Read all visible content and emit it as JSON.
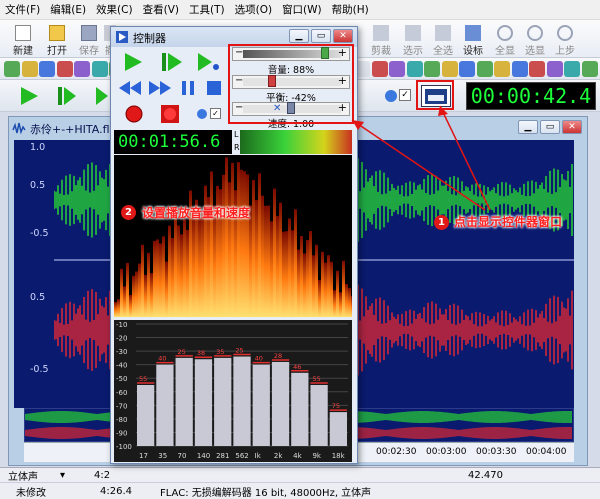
{
  "menu": [
    "文件(F)",
    "编辑(E)",
    "效果(C)",
    "查看(V)",
    "工具(T)",
    "选项(O)",
    "窗口(W)",
    "帮助(H)"
  ],
  "toolbar1": {
    "left": [
      "新建",
      "打开",
      "保存",
      "撤"
    ],
    "right": [
      "剪裁",
      "选示",
      "全选",
      "设标",
      "全显",
      "选显",
      "上步"
    ]
  },
  "main_time": "00:00:42.4",
  "document": {
    "title": "赤伶+-+HITA.fla"
  },
  "y_labels": {
    "top": [
      "1.0",
      "0.5",
      "-0.5"
    ],
    "bottom": [
      "0.5",
      "-0.5"
    ]
  },
  "ruler_labels": [
    "00:02:30",
    "00:03:00",
    "00:03:30",
    "00:04:00"
  ],
  "status1": {
    "channel": "立体声",
    "value1": "4:2",
    "value2": "42.470"
  },
  "status2": {
    "state": "未修改",
    "duration": "4:26.4",
    "format": "FLAC: 无损编解码器 16 bit, 48000Hz, 立体声"
  },
  "controller": {
    "title": "控制器",
    "volume_label": "音量: 88%",
    "volume": 0.88,
    "balance_label": "平衡: -42%",
    "balance": -0.42,
    "speed_label": "速度: 1.00",
    "speed": 1.0,
    "time": "00:01:56.6",
    "meter_L": "L",
    "meter_R": "R"
  },
  "annotations": {
    "step1_num": "1",
    "step1_text": "点击显示控件器窗口",
    "step2_num": "2",
    "step2_text": "设置播放音量和速度"
  },
  "chart_data": {
    "type": "bar",
    "categories": [
      "17",
      "35",
      "70",
      "140",
      "281",
      "562",
      "Ik",
      "2k",
      "4k",
      "9k",
      "18k"
    ],
    "values": [
      -55,
      -40,
      -35,
      -36,
      -35,
      -34,
      -40,
      -38,
      -46,
      -55,
      -75
    ],
    "data_labels": [
      "55",
      "40",
      "25",
      "38",
      "35",
      "25",
      "40",
      "28",
      "46",
      "55",
      "75"
    ],
    "ylim": [
      -100,
      -10
    ],
    "y_ticks": [
      "-10",
      "-20",
      "-30",
      "-40",
      "-50",
      "-60",
      "-70",
      "-80",
      "-90",
      "-100"
    ]
  },
  "colors": {
    "wave_top": "#2cf02c",
    "wave_bottom": "#ff2a2a",
    "wave_bg": "#0a1a6e",
    "lcd": "#1cff3a",
    "annotation": "#ff2020"
  }
}
